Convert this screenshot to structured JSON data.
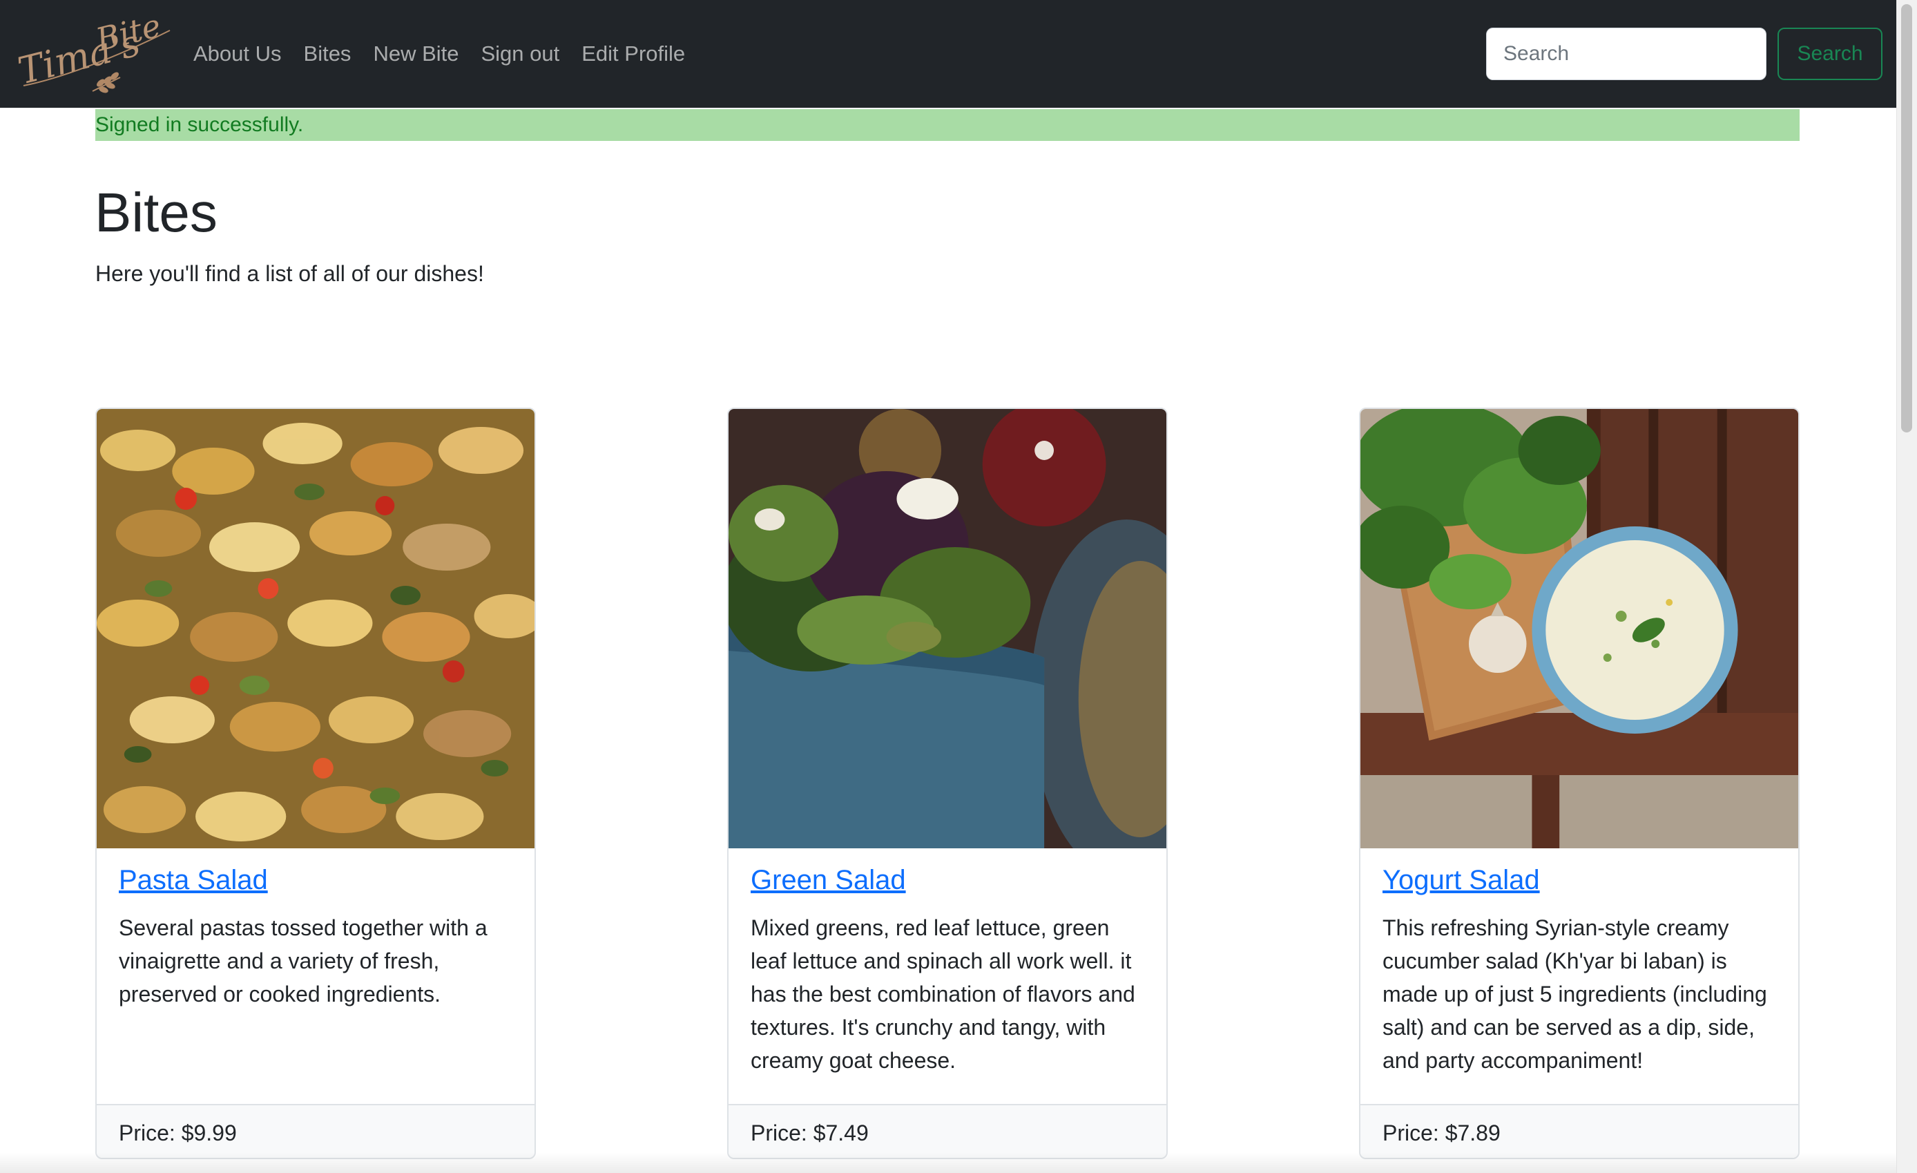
{
  "navbar": {
    "brand_logo": "Tima's Bite",
    "links": [
      "About Us",
      "Bites",
      "New Bite",
      "Sign out",
      "Edit Profile"
    ],
    "search_placeholder": "Search",
    "search_button": "Search"
  },
  "alert": {
    "message": "Signed in successfully."
  },
  "header": {
    "title": "Bites",
    "subtitle": "Here you'll find a list of all of our dishes!"
  },
  "cards": [
    {
      "title": "Pasta Salad",
      "text": "Several pastas tossed together with a vinaigrette and a variety of fresh, preserved or cooked ingredients.",
      "price": "Price: $9.99"
    },
    {
      "title": "Green Salad",
      "text": "Mixed greens, red leaf lettuce, green leaf lettuce and spinach all work well. it has the best combination of flavors and textures. It's crunchy and tangy, with creamy goat cheese.",
      "price": "Price: $7.49"
    },
    {
      "title": "Yogurt Salad",
      "text": "This refreshing Syrian-style creamy cucumber salad (Kh'yar bi laban) is made up of just 5 ingredients (including salt) and can be served as a dip, side, and party accompaniment!",
      "price": "Price: $7.89"
    }
  ],
  "colors": {
    "navbar_bg": "#212529",
    "alert_bg": "#a8dca5",
    "alert_text": "#127b21",
    "link": "#0d6efd",
    "search_button": "#198754"
  }
}
